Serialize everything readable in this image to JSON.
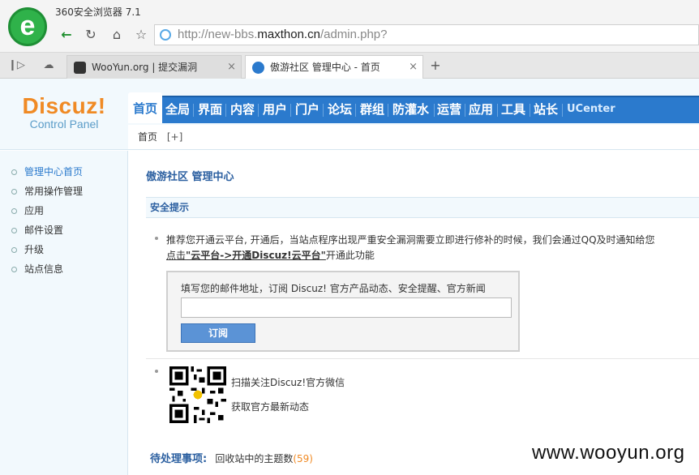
{
  "browser": {
    "title": "360安全浏览器 7.1",
    "url_prefix": "http://new-bbs.",
    "url_domain": "maxthon.cn",
    "url_path": "/admin.php?",
    "tabs": [
      {
        "label": "WooYun.org | 提交漏洞",
        "active": false
      },
      {
        "label": "傲游社区 管理中心 - 首页",
        "active": true
      }
    ],
    "close_glyph": "×",
    "new_tab_glyph": "+"
  },
  "logo": {
    "brand": "Discuz!",
    "sub": "Control Panel"
  },
  "nav": {
    "items": [
      "首页",
      "全局",
      "界面",
      "内容",
      "用户",
      "门户",
      "论坛",
      "群组",
      "防灌水",
      "运营",
      "应用",
      "工具",
      "站长",
      "UCenter"
    ],
    "active_index": 0
  },
  "subnav": {
    "home": "首页",
    "add": "[+]"
  },
  "sidebar": {
    "items": [
      "管理中心首页",
      "常用操作管理",
      "应用",
      "邮件设置",
      "升级",
      "站点信息"
    ],
    "active_index": 0
  },
  "main": {
    "title": "傲游社区 管理中心",
    "section_title": "安全提示",
    "notice_text": "推荐您开通云平台, 开通后，当站点程序出现严重安全漏洞需要立即进行修补的时候，我们会通过QQ及时通知给您",
    "notice_link_prefix": "点击",
    "notice_link_bold": "\"云平台->开通Discuz!云平台\"",
    "notice_link_suffix": "开通此功能",
    "subscribe_label": "填写您的邮件地址，订阅 Discuz! 官方产品动态、安全提醒、官方新闻",
    "subscribe_value": "",
    "subscribe_button": "订阅",
    "qr_line1": "扫描关注Discuz!官方微信",
    "qr_line2": "获取官方最新动态",
    "pending_label": "待处理事项:",
    "pending_link": "回收站中的主题数",
    "pending_count": "(59)"
  },
  "watermark": "www.wooyun.org",
  "colors": {
    "brand_orange": "#f08a24",
    "nav_blue": "#2b7acd",
    "title_blue": "#2b5fa0",
    "browser_green": "#2fb24a"
  }
}
